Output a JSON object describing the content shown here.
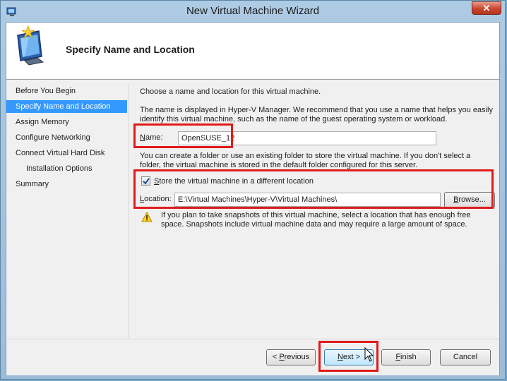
{
  "window": {
    "title": "New Virtual Machine Wizard",
    "close_label": "✕"
  },
  "header": {
    "title": "Specify Name and Location"
  },
  "nav": {
    "items": [
      {
        "label": "Before You Begin",
        "active": false,
        "sub": false
      },
      {
        "label": "Specify Name and Location",
        "active": true,
        "sub": false
      },
      {
        "label": "Assign Memory",
        "active": false,
        "sub": false
      },
      {
        "label": "Configure Networking",
        "active": false,
        "sub": false
      },
      {
        "label": "Connect Virtual Hard Disk",
        "active": false,
        "sub": false
      },
      {
        "label": "Installation Options",
        "active": false,
        "sub": true
      },
      {
        "label": "Summary",
        "active": false,
        "sub": false
      }
    ]
  },
  "content": {
    "intro": "Choose a name and location for this virtual machine.",
    "name_help_1": "The name is displayed in Hyper-V Manager. We recommend that you use a name that helps you easily",
    "name_help_2": "identify this virtual machine, such as the name of the guest operating system or workload.",
    "name_label_access": "N",
    "name_label_rest": "ame:",
    "name_value": "OpenSUSE_12",
    "folder_help_1": "You can create a folder or use an existing folder to store the virtual machine. If you don't select a",
    "folder_help_2": "folder, the virtual machine is stored in the default folder configured for this server.",
    "store_checkbox_access": "S",
    "store_checkbox_rest": "tore the virtual machine in a different location",
    "store_checked": true,
    "location_label_access": "L",
    "location_label_rest": "ocation:",
    "location_value": "E:\\Virtual Machines\\Hyper-V\\Virtual Machines\\",
    "browse_access": "B",
    "browse_rest": "rowse...",
    "warning_1": "If you plan to take snapshots of this virtual machine, select a location that has enough free",
    "warning_2": "space. Snapshots include virtual machine data and may require a large amount of space."
  },
  "footer": {
    "previous_pre": "< ",
    "previous_access": "P",
    "previous_rest": "revious",
    "next_access": "N",
    "next_rest": "ext >",
    "finish_access": "F",
    "finish_rest": "inish",
    "cancel": "Cancel"
  },
  "colors": {
    "selection": "#3399ff",
    "highlight_box": "#e01b1b"
  },
  "icons": [
    "app-icon",
    "wizard-computer-icon",
    "warning-icon",
    "checkmark-icon",
    "mouse-cursor-icon"
  ]
}
